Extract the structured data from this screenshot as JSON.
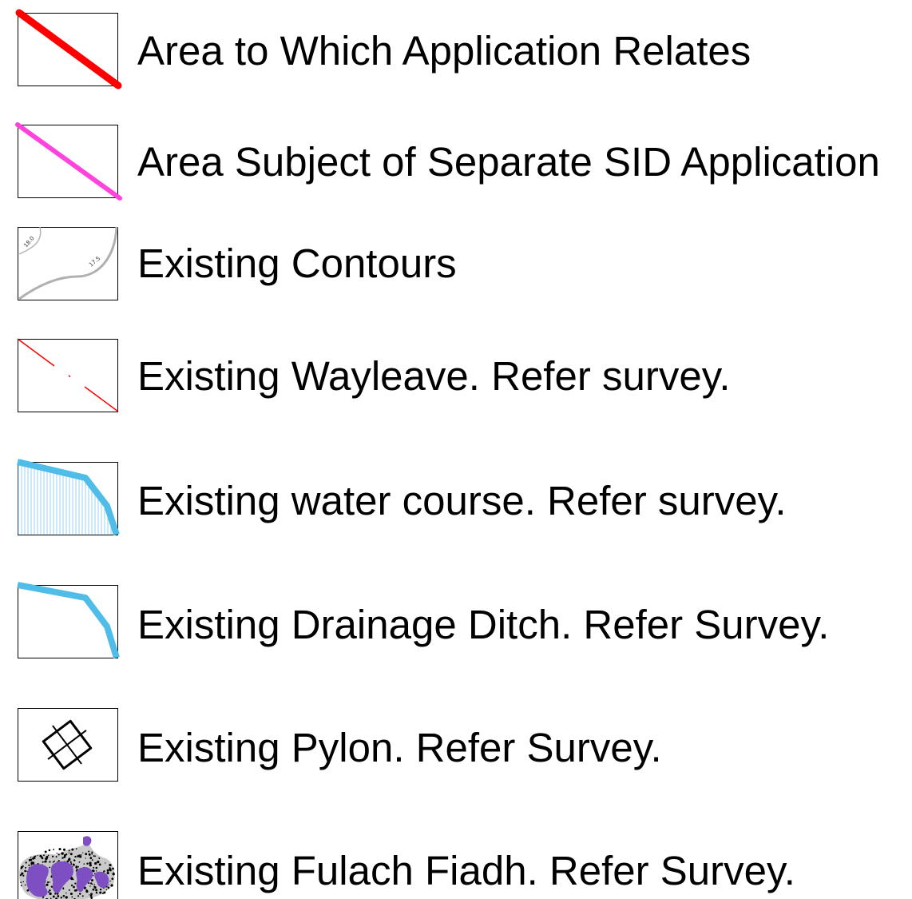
{
  "legend": {
    "items": [
      {
        "key": "area-application",
        "label": "Area to Which Application Relates",
        "color": "#ff0000",
        "icon": "thick-red-diagonal-line"
      },
      {
        "key": "area-sid",
        "label": "Area Subject of Separate SID Application",
        "color": "#ff44dd",
        "icon": "pink-diagonal-line"
      },
      {
        "key": "contours",
        "label": "Existing Contours",
        "color": "#b0b0b0",
        "icon": "grey-contour-lines",
        "contour_labels": [
          "18.0",
          "17.5"
        ]
      },
      {
        "key": "wayleave",
        "label": "Existing Wayleave. Refer survey.",
        "color": "#ff0000",
        "icon": "red-dashed-diagonal-line"
      },
      {
        "key": "water-course",
        "label": "Existing water course. Refer survey.",
        "color": "#4fbde8",
        "icon": "blue-hatched-water-area"
      },
      {
        "key": "drainage-ditch",
        "label": "Existing Drainage Ditch. Refer Survey.",
        "color": "#4fbde8",
        "icon": "blue-ditch-line"
      },
      {
        "key": "pylon",
        "label": "Existing Pylon. Refer Survey.",
        "color": "#000000",
        "icon": "pylon-diamond-cross-icon"
      },
      {
        "key": "fulach-fiadh",
        "label": "Existing Fulach Fiadh. Refer Survey.",
        "color": "#7e4fc3",
        "icon": "purple-speckled-feature"
      }
    ]
  }
}
